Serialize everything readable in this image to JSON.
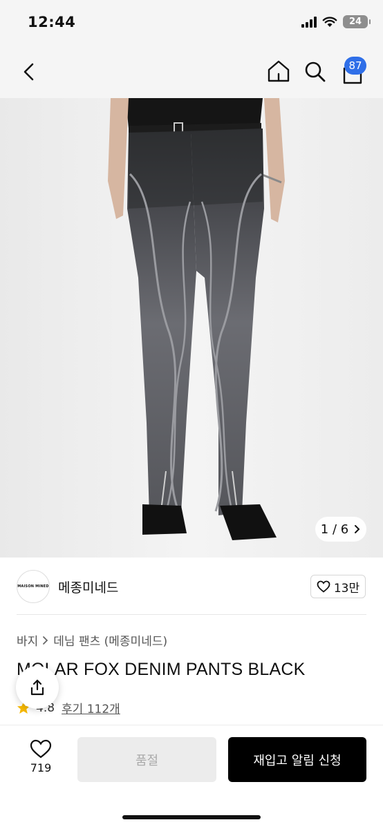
{
  "status_bar": {
    "time": "12:44",
    "battery": "24"
  },
  "nav": {
    "cart_count": "87"
  },
  "hero": {
    "counter": "1 / 6"
  },
  "brand": {
    "logo_text": "MAISON MINED",
    "name": "메종미네드",
    "likes": "13만"
  },
  "product": {
    "breadcrumb": [
      "바지",
      "데님 팬츠 (메종미네드)"
    ],
    "title": "MOLAR FOX DENIM PANTS BLACK",
    "rating": "4.8",
    "reviews": "후기 112개"
  },
  "bottom": {
    "wish_count": "719",
    "soldout_label": "품절",
    "restock_label": "재입고 알림 신청"
  },
  "colors": {
    "badge": "#2f6fe8",
    "star": "#f6b800",
    "primary_button": "#000000"
  }
}
